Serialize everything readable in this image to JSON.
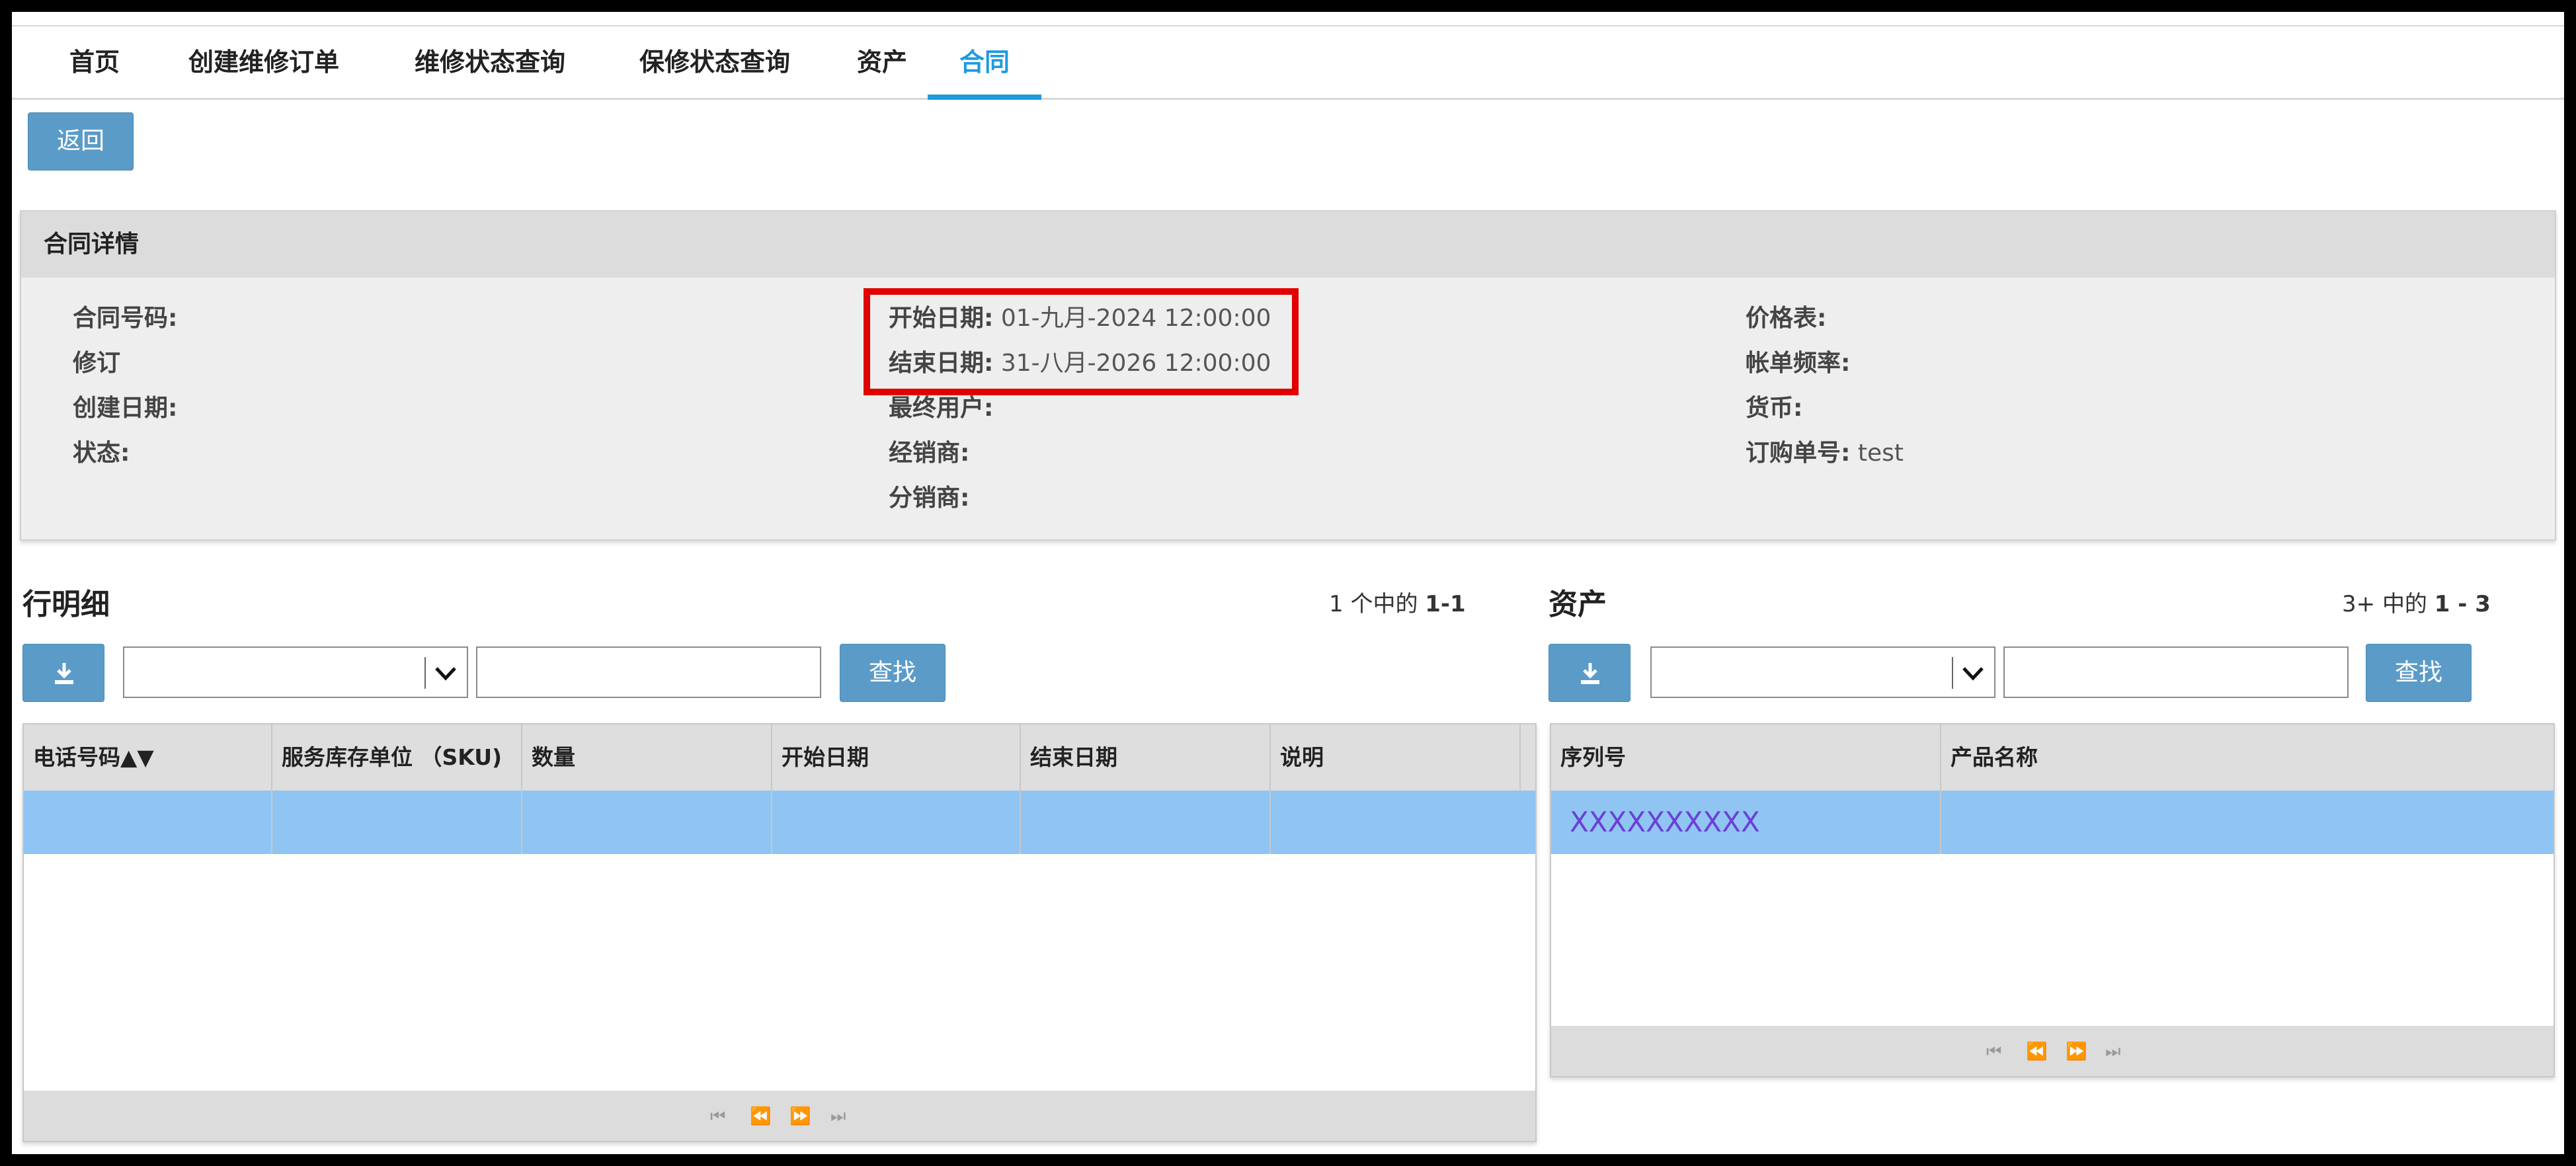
{
  "nav": {
    "tabs": [
      {
        "label": "首页"
      },
      {
        "label": "创建维修订单"
      },
      {
        "label": "维修状态查询"
      },
      {
        "label": "保修状态查询"
      },
      {
        "label": "资产"
      },
      {
        "label": "合同"
      }
    ],
    "active_tab": "合同"
  },
  "back_button": "返回",
  "details": {
    "title": "合同详情",
    "col1": {
      "contract_no": "合同号码:",
      "revision": "修订",
      "created": "创建日期:",
      "status": "状态:"
    },
    "col2": {
      "start_label": "开始日期:",
      "start_value": "01-九月-2024 12:00:00",
      "end_label": "结束日期:",
      "end_value": "31-八月-2026 12:00:00",
      "end_user": "最终用户:",
      "dealer": "经销商:",
      "distributor": "分销商:"
    },
    "col3": {
      "price_list": "价格表:",
      "billing_freq": "帐单频率:",
      "currency": "货币:",
      "po_label": "订购单号:",
      "po_value": "test"
    }
  },
  "lines": {
    "title": "行明细",
    "pager": {
      "count": "1",
      "middle": "个中的",
      "range": "1-1"
    },
    "search_button": "查找",
    "columns": [
      "电话号码▲▼",
      "服务库存单位 （SKU)",
      "数量",
      "开始日期",
      "结束日期",
      "说明"
    ]
  },
  "assets": {
    "title": "资产",
    "pager": {
      "count": "3+",
      "middle": "中的",
      "range": "1 - 3"
    },
    "search_button": "查找",
    "columns": [
      "序列号",
      "产品名称"
    ],
    "rows": [
      {
        "serial": "XXXXXXXXXX",
        "product": ""
      }
    ]
  },
  "colors": {
    "accent": "#1e9ae0",
    "button": "#5b9bc8",
    "selected_row": "#90c4f2",
    "highlight_border": "#e00000"
  },
  "icons": {
    "download": "download-icon",
    "dropdown": "chevron-down-icon",
    "pager": [
      "first-page-icon",
      "prev-page-icon",
      "next-page-icon",
      "last-page-icon"
    ]
  }
}
